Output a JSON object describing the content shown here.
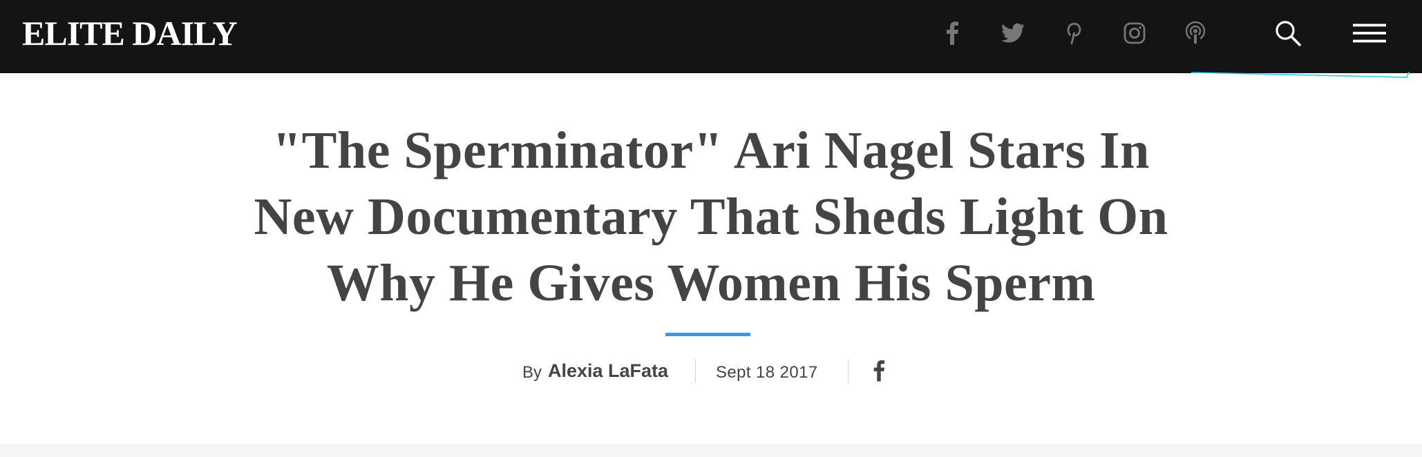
{
  "header": {
    "logo_text": "ELITE DAILY",
    "social": [
      {
        "icon": "facebook-icon"
      },
      {
        "icon": "twitter-icon"
      },
      {
        "icon": "pinterest-icon"
      },
      {
        "icon": "instagram-icon"
      },
      {
        "icon": "podcast-icon"
      }
    ],
    "tools": [
      {
        "icon": "search-icon"
      },
      {
        "icon": "hamburger-menu-icon"
      }
    ]
  },
  "article": {
    "title": "\"The Sperminator\" Ari Nagel Stars In New Documentary That Sheds Light On Why He Gives Women His Sperm",
    "byline_prefix": "By",
    "author": "Alexia LaFata",
    "date": "Sept 18 2017",
    "share": {
      "icon": "facebook-icon"
    }
  },
  "colors": {
    "header_bg": "#141414",
    "social_icon": "#777777",
    "text": "#444444",
    "accent": "#3a9ae8",
    "progress_line": "#2ec8e8"
  }
}
